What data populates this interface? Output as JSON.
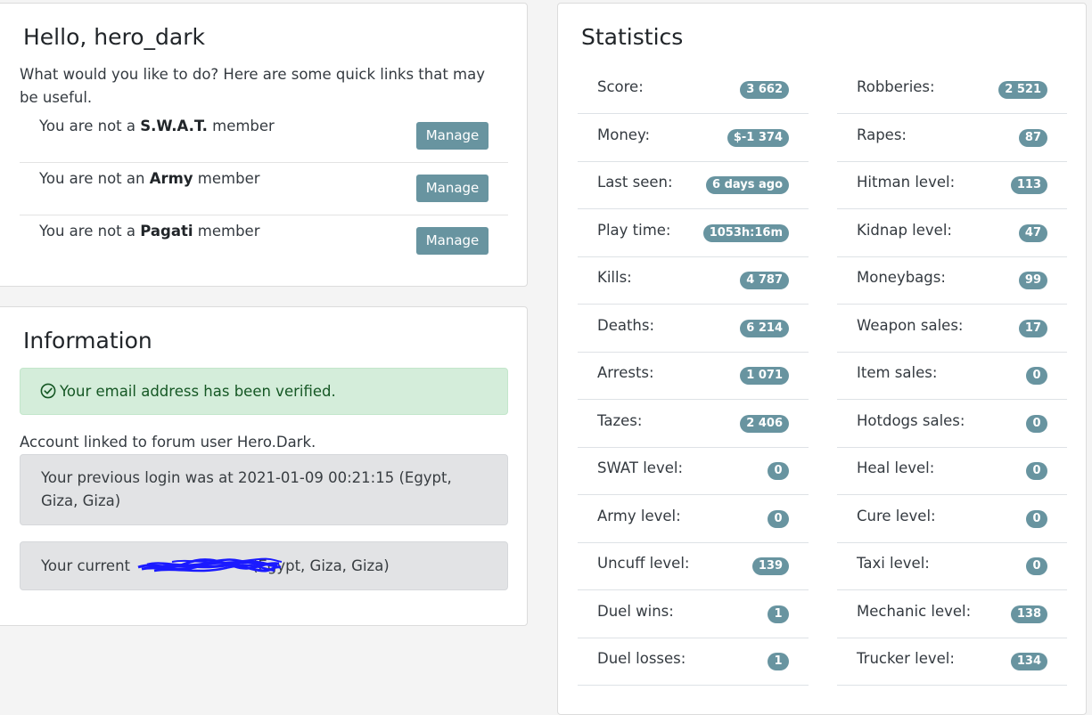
{
  "hello_card": {
    "title": "Hello, hero_dark",
    "intro": "What would you like to do? Here are some quick links that may be useful.",
    "memberships": [
      {
        "prefix": "You are not a ",
        "group": "S.W.A.T.",
        "suffix": " member",
        "button": "Manage"
      },
      {
        "prefix": "You are not an ",
        "group": "Army",
        "suffix": " member",
        "button": "Manage"
      },
      {
        "prefix": "You are not a ",
        "group": "Pagati",
        "suffix": " member",
        "button": "Manage"
      }
    ]
  },
  "info_card": {
    "title": "Information",
    "verified": "Your email address has been verified.",
    "linked": "Account linked to forum user Hero.Dark.",
    "previous_login": "Your previous login was at 2021-01-09 00:21:15 (Egypt, Giza, Giza)",
    "current_login_prefix": "Your current",
    "current_login_suffix": "(Egypt, Giza, Giza)"
  },
  "stats_card": {
    "title": "Statistics",
    "left": [
      {
        "label": "Score:",
        "value": "3 662"
      },
      {
        "label": "Money:",
        "value": "$-1 374"
      },
      {
        "label": "Last seen:",
        "value": "6 days ago"
      },
      {
        "label": "Play time:",
        "value": "1053h:16m"
      },
      {
        "label": "Kills:",
        "value": "4 787"
      },
      {
        "label": "Deaths:",
        "value": "6 214"
      },
      {
        "label": "Arrests:",
        "value": "1 071"
      },
      {
        "label": "Tazes:",
        "value": "2 406"
      },
      {
        "label": "SWAT level:",
        "value": "0"
      },
      {
        "label": "Army level:",
        "value": "0"
      },
      {
        "label": "Uncuff level:",
        "value": "139"
      },
      {
        "label": "Duel wins:",
        "value": "1"
      },
      {
        "label": "Duel losses:",
        "value": "1"
      }
    ],
    "right": [
      {
        "label": "Robberies:",
        "value": "2 521"
      },
      {
        "label": "Rapes:",
        "value": "87"
      },
      {
        "label": "Hitman level:",
        "value": "113"
      },
      {
        "label": "Kidnap level:",
        "value": "47"
      },
      {
        "label": "Moneybags:",
        "value": "99"
      },
      {
        "label": "Weapon sales:",
        "value": "17"
      },
      {
        "label": "Item sales:",
        "value": "0"
      },
      {
        "label": "Hotdogs sales:",
        "value": "0"
      },
      {
        "label": "Heal level:",
        "value": "0"
      },
      {
        "label": "Cure level:",
        "value": "0"
      },
      {
        "label": "Taxi level:",
        "value": "0"
      },
      {
        "label": "Mechanic level:",
        "value": "138"
      },
      {
        "label": "Trucker level:",
        "value": "134"
      }
    ]
  },
  "icons": {
    "verified": "check-circle-icon"
  },
  "colors": {
    "badge": "#6894a0",
    "button": "#6894a0",
    "success_bg": "#d4edda",
    "success_text": "#155724",
    "info_bg": "#e2e3e5",
    "redaction": "#1a1aff"
  }
}
